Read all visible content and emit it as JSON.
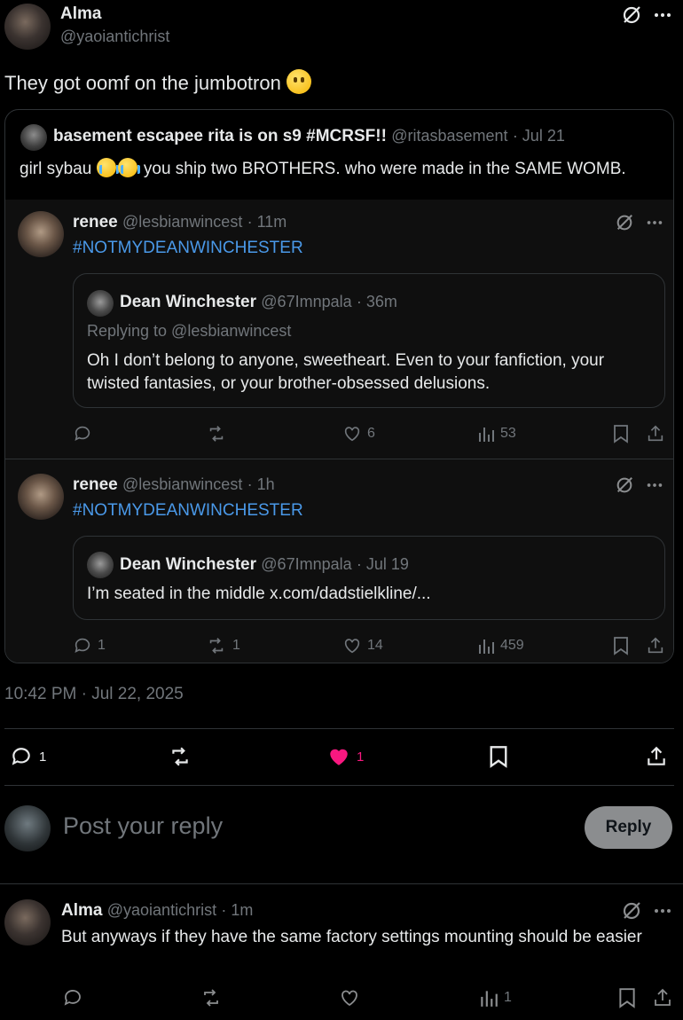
{
  "main_post": {
    "author_name": "Alma",
    "author_handle": "@yaoiantichrist",
    "text": "They got oomf on the jumbotron",
    "timestamp": "10:42 PM · Jul 22, 2025",
    "actions": {
      "replies": "1",
      "likes": "1"
    }
  },
  "quote": {
    "author_name": "basement escapee rita is on s9 #MCRSF!!",
    "author_handle": "@ritasbasement",
    "date": "· Jul 21",
    "text_pre": "girl sybau",
    "text_post": "you ship two BROTHERS. who were made in the SAME WOMB."
  },
  "nested_posts": [
    {
      "author_name": "renee",
      "author_handle": "@lesbianwincest",
      "time": "· 11m",
      "hashtag": "#NOTMYDEANWINCHESTER",
      "inner": {
        "author_name": "Dean Winchester",
        "author_handle": "@67Imnpala",
        "time": "· 36m",
        "replying_to": "Replying to @lesbianwincest",
        "text": "Oh I don’t belong to anyone, sweetheart. Even to your fanfiction, your twisted fantasies, or your brother-obsessed delusions."
      },
      "stats": {
        "replies": "",
        "reposts": "",
        "likes": "6",
        "views": "53"
      }
    },
    {
      "author_name": "renee",
      "author_handle": "@lesbianwincest",
      "time": "· 1h",
      "hashtag": "#NOTMYDEANWINCHESTER",
      "inner": {
        "author_name": "Dean Winchester",
        "author_handle": "@67Imnpala",
        "time": "· Jul 19",
        "text": "I’m seated in the middle x.com/dadstielkline/..."
      },
      "stats": {
        "replies": "1",
        "reposts": "1",
        "likes": "14",
        "views": "459"
      }
    }
  ],
  "composer": {
    "placeholder": "Post your reply",
    "button_label": "Reply"
  },
  "reply": {
    "author_name": "Alma",
    "author_handle": "@yaoiantichrist",
    "time": "· 1m",
    "text": "But anyways if they have the same factory settings mounting should be easier",
    "stats": {
      "views": "1"
    }
  },
  "colors": {
    "accent": "#4a99e9",
    "like": "#f91880",
    "muted": "#71767b",
    "border": "#2f3336"
  }
}
